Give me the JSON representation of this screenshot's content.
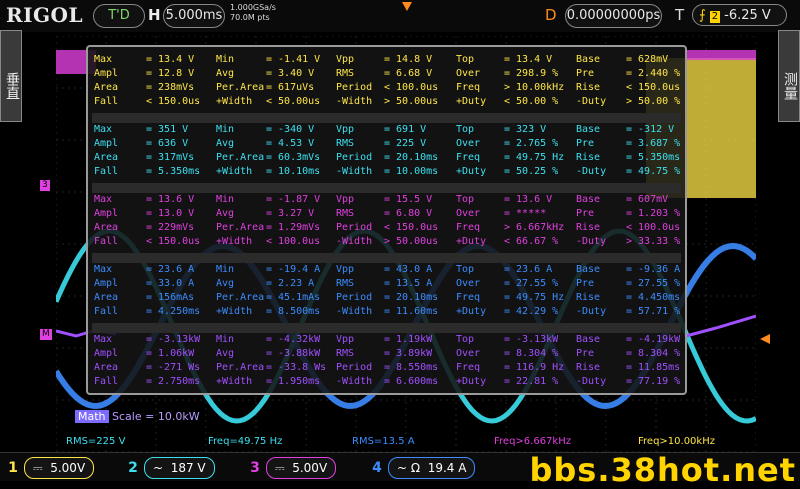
{
  "header": {
    "brand": "RIGOL",
    "run_mode": "T'D",
    "horizontal_label": "H",
    "timebase": "5.000ms",
    "sample_rate": "1.000GSa/s",
    "memory_depth": "70.0M pts",
    "delay_label": "D",
    "delay": "0.00000000ps",
    "trigger_label": "T",
    "trigger_channel": "2",
    "trigger_level": "-6.25 V"
  },
  "side_tabs": {
    "left": "垂直",
    "right": "测量"
  },
  "markers": {
    "ch3": "3",
    "math": "M"
  },
  "colors": {
    "ch1": "#ffe64a",
    "ch2": "#3de0f0",
    "ch3": "#e040e0",
    "ch4": "#3c8cff",
    "math": "#a050ff",
    "trigger": "#ff8a1e"
  },
  "measurements": [
    {
      "rows": [
        [
          "Max",
          "= 13.4 V",
          "Min",
          "= -1.41 V",
          "Vpp",
          "= 14.8 V",
          "Top",
          "= 13.4 V",
          "Base",
          "= 628mV"
        ],
        [
          "Ampl",
          "= 12.8 V",
          "Avg",
          "= 3.40 V",
          "RMS",
          "= 6.68 V",
          "Over",
          "= 298.9 %",
          "Pre",
          "= 2.440 %"
        ],
        [
          "Area",
          "= 238mVs",
          "Per.Area",
          "= 617uVs",
          "Period",
          "< 100.0us",
          "Freq",
          "> 10.00kHz",
          "Rise",
          "< 150.0us"
        ],
        [
          "Fall",
          "< 150.0us",
          "+Width",
          "< 50.00us",
          "-Width",
          "> 50.00us",
          "+Duty",
          "< 50.00 %",
          "-Duty",
          "> 50.00 %"
        ]
      ]
    },
    {
      "rows": [
        [
          "Max",
          "= 351 V",
          "Min",
          "= -340 V",
          "Vpp",
          "= 691 V",
          "Top",
          "= 323 V",
          "Base",
          "= -312 V"
        ],
        [
          "Ampl",
          "= 636 V",
          "Avg",
          "= 4.53 V",
          "RMS",
          "= 225 V",
          "Over",
          "= 2.765 %",
          "Pre",
          "= 3.687 %"
        ],
        [
          "Area",
          "= 317mVs",
          "Per.Area",
          "= 60.3mVs",
          "Period",
          "= 20.10ms",
          "Freq",
          "= 49.75 Hz",
          "Rise",
          "= 5.350ms"
        ],
        [
          "Fall",
          "= 5.350ms",
          "+Width",
          "= 10.10ms",
          "-Width",
          "= 10.00ms",
          "+Duty",
          "= 50.25 %",
          "-Duty",
          "= 49.75 %"
        ]
      ]
    },
    {
      "rows": [
        [
          "Max",
          "= 13.6 V",
          "Min",
          "= -1.87 V",
          "Vpp",
          "= 15.5 V",
          "Top",
          "= 13.6 V",
          "Base",
          "= 607mV"
        ],
        [
          "Ampl",
          "= 13.0 V",
          "Avg",
          "= 3.27 V",
          "RMS",
          "= 6.80 V",
          "Over",
          "= *****",
          "Pre",
          "= 1.203 %"
        ],
        [
          "Area",
          "= 229mVs",
          "Per.Area",
          "= 1.29mVs",
          "Period",
          "< 150.0us",
          "Freq",
          "> 6.667kHz",
          "Rise",
          "< 100.0us"
        ],
        [
          "Fall",
          "< 150.0us",
          "+Width",
          "< 100.0us",
          "-Width",
          "> 50.00us",
          "+Duty",
          "< 66.67 %",
          "-Duty",
          "> 33.33 %"
        ]
      ]
    },
    {
      "rows": [
        [
          "Max",
          "= 23.6 A",
          "Min",
          "= -19.4 A",
          "Vpp",
          "= 43.0 A",
          "Top",
          "= 23.6 A",
          "Base",
          "= -9.36 A"
        ],
        [
          "Ampl",
          "= 33.0 A",
          "Avg",
          "= 2.23 A",
          "RMS",
          "= 13.5 A",
          "Over",
          "= 27.55 %",
          "Pre",
          "= 27.55 %"
        ],
        [
          "Area",
          "= 156mAs",
          "Per.Area",
          "= 45.1mAs",
          "Period",
          "= 20.10ms",
          "Freq",
          "= 49.75 Hz",
          "Rise",
          "= 4.450ms"
        ],
        [
          "Fall",
          "= 4.250ms",
          "+Width",
          "= 8.500ms",
          "-Width",
          "= 11.60ms",
          "+Duty",
          "= 42.29 %",
          "-Duty",
          "= 57.71 %"
        ]
      ]
    },
    {
      "rows": [
        [
          "Max",
          "= -3.13kW",
          "Min",
          "= -4.32kW",
          "Vpp",
          "= 1.19kW",
          "Top",
          "= -3.13kW",
          "Base",
          "= -4.19kW"
        ],
        [
          "Ampl",
          "= 1.06kW",
          "Avg",
          "= -3.88kW",
          "RMS",
          "= 3.89kW",
          "Over",
          "= 8.304 %",
          "Pre",
          "= 8.304 %"
        ],
        [
          "Area",
          "= -271 Ws",
          "Per.Area",
          "= -33.8 Ws",
          "Period",
          "= 8.550ms",
          "Freq",
          "= 116.9 Hz",
          "Rise",
          "= 11.85ms"
        ],
        [
          "Fall",
          "= 2.750ms",
          "+Width",
          "= 1.950ms",
          "-Width",
          "= 6.600ms",
          "+Duty",
          "= 22.81 %",
          "-Duty",
          "= 77.19 %"
        ]
      ]
    }
  ],
  "math": {
    "label": "Math",
    "scale": "Scale = 10.0kW"
  },
  "readouts": [
    "RMS=225 V",
    "Freq=49.75 Hz",
    "RMS=13.5 A",
    "Freq>6.667kHz",
    "Freq>10.00kHz"
  ],
  "channels": [
    {
      "num": "1",
      "coupling": "⎓",
      "scale": "5.00V"
    },
    {
      "num": "2",
      "coupling": "~",
      "scale": "187 V"
    },
    {
      "num": "3",
      "coupling": "⎓",
      "scale": "5.00V"
    },
    {
      "num": "4",
      "coupling": "~ Ω",
      "scale": "19.4 A"
    }
  ],
  "watermark": "bbs.38hot.net"
}
